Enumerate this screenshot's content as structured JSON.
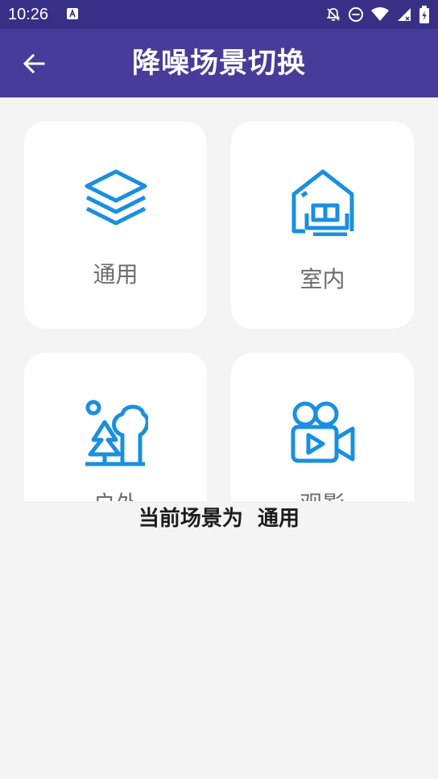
{
  "status_bar": {
    "time": "10:26",
    "icons": [
      "notification-app-icon",
      "bell-off-icon",
      "do-not-disturb-icon",
      "wifi-icon",
      "signal-icon",
      "battery-icon"
    ]
  },
  "app_bar": {
    "back_icon": "arrow-left-icon",
    "title": "降噪场景切换",
    "color": "#473c9a"
  },
  "scenes": [
    {
      "label": "通用",
      "icon": "layers-icon"
    },
    {
      "label": "室内",
      "icon": "home-sofa-icon"
    },
    {
      "label": "户外",
      "icon": "tree-outdoor-icon"
    },
    {
      "label": "观影",
      "icon": "video-camera-icon"
    }
  ],
  "current_scene": {
    "prefix": "当前场景为",
    "value": "通用"
  },
  "colors": {
    "icon_blue": "#1a8fe0",
    "status_bar": "#3a2f86",
    "background": "#f4f4f4"
  }
}
